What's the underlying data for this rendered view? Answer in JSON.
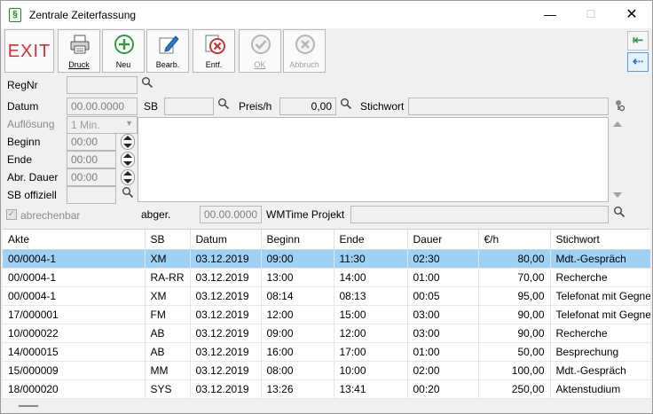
{
  "window": {
    "title": "Zentrale Zeiterfassung",
    "minimize": "—",
    "maximize": "☐",
    "close": "✕"
  },
  "toolbar": {
    "exit": "EXIT",
    "buttons": [
      {
        "label": "Druck",
        "icon": "printer-icon"
      },
      {
        "label": "Neu",
        "icon": "plus-icon"
      },
      {
        "label": "Bearb.",
        "icon": "pencil-icon"
      },
      {
        "label": "Entf.",
        "icon": "delete-icon"
      },
      {
        "label": "OK",
        "icon": "check-icon",
        "disabled": true
      },
      {
        "label": "Abbruch",
        "icon": "cancel-icon",
        "disabled": true
      }
    ],
    "side": {
      "back": "⇤",
      "collapse": "⇠"
    }
  },
  "form": {
    "regnr_label": "RegNr",
    "regnr_value": "",
    "datum_label": "Datum",
    "datum_value": "00.00.0000",
    "sb_label": "SB",
    "sb_value": "",
    "preis_label": "Preis/h",
    "preis_value": "0,00",
    "stichwort_label": "Stichwort",
    "stichwort_value": "",
    "aufloesung_label": "Auflösung",
    "aufloesung_value": "1 Min.",
    "beginn_label": "Beginn",
    "beginn_value": "00:00",
    "ende_label": "Ende",
    "ende_value": "00:00",
    "abr_dauer_label": "Abr. Dauer",
    "abr_dauer_value": "00:00",
    "sb_offiziell_label": "SB offiziell",
    "sb_offiziell_value": "",
    "abrechenbar_label": "abrechenbar",
    "abger_label": "abger.",
    "abger_value": "00.00.0000",
    "wmtime_label": "WMTime Projekt",
    "wmtime_value": ""
  },
  "table": {
    "columns": [
      "Akte",
      "SB",
      "Datum",
      "Beginn",
      "Ende",
      "Dauer",
      "€/h",
      "Stichwort"
    ],
    "rows": [
      [
        "00/0004-1",
        "XM",
        "03.12.2019",
        "09:00",
        "11:30",
        "02:30",
        "80,00",
        "Mdt.-Gespräch"
      ],
      [
        "00/0004-1",
        "RA-RR",
        "03.12.2019",
        "13:00",
        "14:00",
        "01:00",
        "70,00",
        "Recherche"
      ],
      [
        "00/0004-1",
        "XM",
        "03.12.2019",
        "08:14",
        "08:13",
        "00:05",
        "95,00",
        "Telefonat mit Gegner"
      ],
      [
        "17/000001",
        "FM",
        "03.12.2019",
        "12:00",
        "15:00",
        "03:00",
        "90,00",
        "Telefonat mit Gegner"
      ],
      [
        "10/000022",
        "AB",
        "03.12.2019",
        "09:00",
        "12:00",
        "03:00",
        "90,00",
        "Recherche"
      ],
      [
        "14/000015",
        "AB",
        "03.12.2019",
        "16:00",
        "17:00",
        "01:00",
        "50,00",
        "Besprechung"
      ],
      [
        "15/000009",
        "MM",
        "03.12.2019",
        "08:00",
        "10:00",
        "02:00",
        "100,00",
        "Mdt.-Gespräch"
      ],
      [
        "18/000020",
        "SYS",
        "03.12.2019",
        "13:26",
        "13:41",
        "00:20",
        "250,00",
        "Aktenstudium"
      ]
    ],
    "selected_row": 0
  }
}
